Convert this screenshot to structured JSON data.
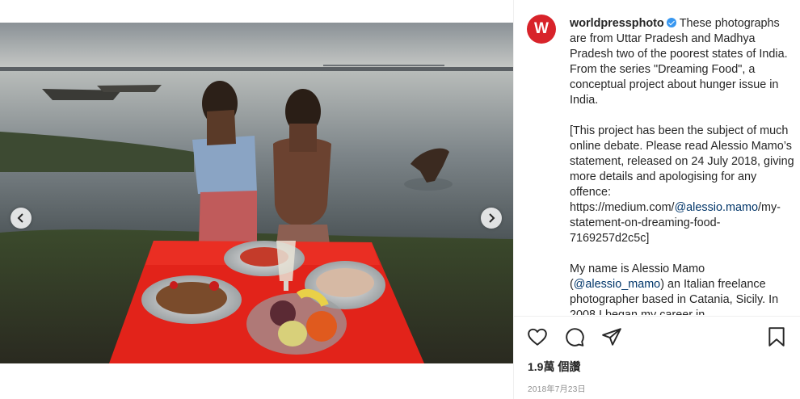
{
  "post": {
    "username": "worldpressphoto",
    "avatar_letter": "W",
    "avatar_color": "#d8232a",
    "verified_icon": "verified-badge-icon",
    "caption_intro": "These photographs are from Uttar Pradesh and Madhya Pradesh two of the poorest states of India. From the series \"Dreaming Food\", a conceptual project about hunger issue in India.",
    "paragraph2_before": "[This project has been the subject of much online debate. Please read Alessio Mamo’s statement, released on 24 July 2018, giving more details and apologising for any offence: https://medium.com/",
    "paragraph2_mention": "@alessio.mamo",
    "paragraph2_after": "/my-statement-on-dreaming-food-7169257d2c5c]",
    "paragraph3_before": "My name is Alessio Mamo (",
    "paragraph3_mention": "@alessio_mamo",
    "paragraph3_after": ") an Italian freelance photographer based in Catania, Sicily. In 2008 I began my career in",
    "likes": "1.9萬 個讚",
    "date": "2018年7月23日"
  },
  "carousel": {
    "prev_icon": "chevron-left-icon",
    "next_icon": "chevron-right-icon"
  },
  "actions": {
    "like_icon": "heart-icon",
    "comment_icon": "comment-icon",
    "share_icon": "share-icon",
    "save_icon": "bookmark-icon"
  },
  "colors": {
    "accent_blue": "#3897f0",
    "mention": "#003569",
    "text": "#262626",
    "muted": "#8e8e8e"
  }
}
